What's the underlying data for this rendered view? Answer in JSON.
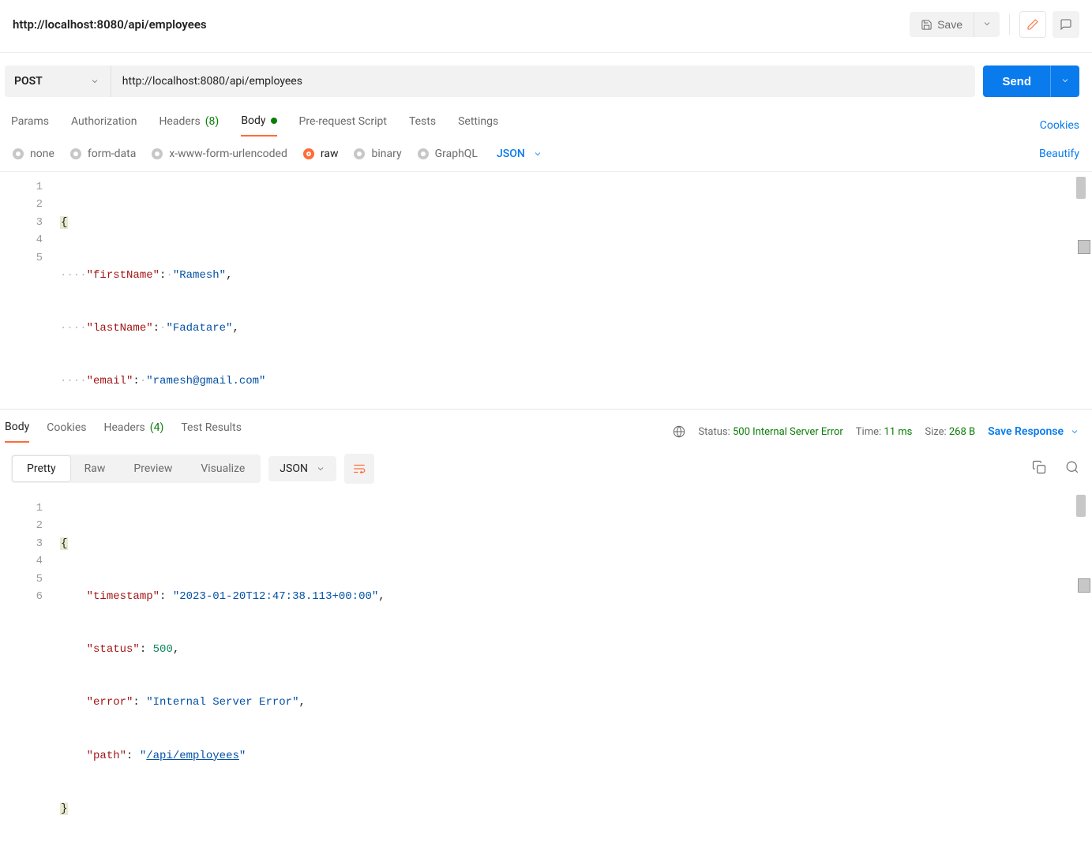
{
  "header": {
    "title": "http://localhost:8080/api/employees",
    "save": "Save"
  },
  "request": {
    "method": "POST",
    "url": "http://localhost:8080/api/employees",
    "send": "Send"
  },
  "tabs": {
    "params": "Params",
    "auth": "Authorization",
    "headers_label": "Headers",
    "headers_count": "(8)",
    "body": "Body",
    "prereq": "Pre-request Script",
    "tests": "Tests",
    "settings": "Settings",
    "cookies": "Cookies"
  },
  "bodytype": {
    "none": "none",
    "formdata": "form-data",
    "xwww": "x-www-form-urlencoded",
    "raw": "raw",
    "binary": "binary",
    "graphql": "GraphQL",
    "format": "JSON",
    "beautify": "Beautify"
  },
  "reqbody": {
    "l1": "{",
    "l2_k": "\"firstName\"",
    "l2_v": "\"Ramesh\"",
    "l3_k": "\"lastName\"",
    "l3_v": "\"Fadatare\"",
    "l4_k": "\"email\"",
    "l4_v": "\"ramesh@gmail.com\"",
    "l5": "}"
  },
  "resp_tabs": {
    "body": "Body",
    "cookies": "Cookies",
    "headers_label": "Headers",
    "headers_count": "(4)",
    "testresults": "Test Results"
  },
  "resp_meta": {
    "status_label": "Status:",
    "status_value": "500 Internal Server Error",
    "time_label": "Time:",
    "time_value": "11 ms",
    "size_label": "Size:",
    "size_value": "268 B",
    "save": "Save Response"
  },
  "resp_view": {
    "pretty": "Pretty",
    "raw": "Raw",
    "preview": "Preview",
    "visualize": "Visualize",
    "format": "JSON"
  },
  "respbody": {
    "l1": "{",
    "l2_k": "\"timestamp\"",
    "l2_v": "\"2023-01-20T12:47:38.113+00:00\"",
    "l3_k": "\"status\"",
    "l3_v": "500",
    "l4_k": "\"error\"",
    "l4_v": "\"Internal Server Error\"",
    "l5_k": "\"path\"",
    "l5_v": "\"",
    "l5_u": "/api/employees",
    "l5_e": "\"",
    "l6": "}"
  }
}
